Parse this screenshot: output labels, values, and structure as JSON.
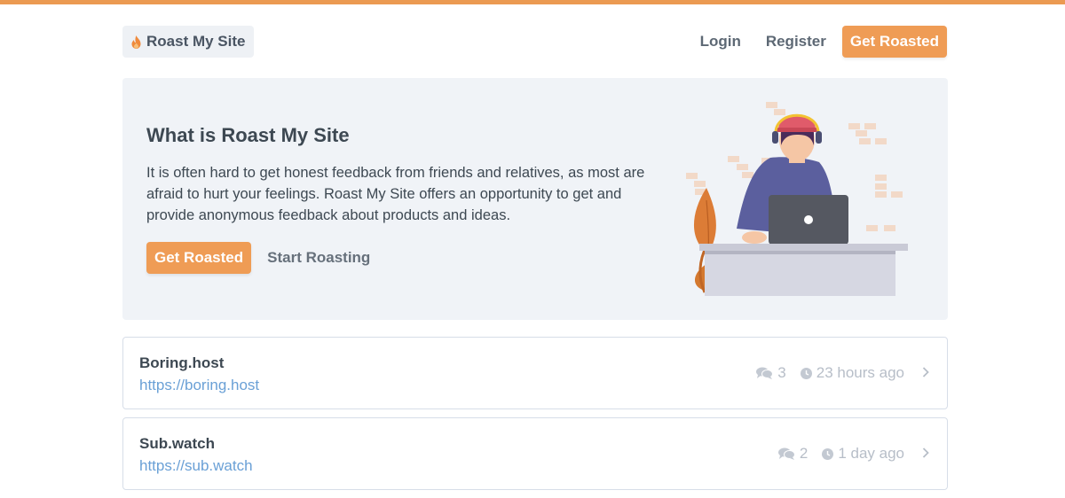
{
  "header": {
    "logo_text": "Roast My Site",
    "nav": {
      "login": "Login",
      "register": "Register",
      "cta": "Get Roasted"
    }
  },
  "hero": {
    "title": "What is Roast My Site",
    "description": "It is often hard to get honest feedback from friends and relatives, as most are afraid to hurt your feelings. Roast My Site offers an opportunity to get and provide anonymous feedback about products and ideas.",
    "primary_button": "Get Roasted",
    "secondary_link": "Start Roasting"
  },
  "sites": [
    {
      "name": "Boring.host",
      "url": "https://boring.host",
      "comments": "3",
      "time": "23 hours ago"
    },
    {
      "name": "Sub.watch",
      "url": "https://sub.watch",
      "comments": "2",
      "time": "1 day ago"
    }
  ],
  "colors": {
    "accent": "#ef9c55",
    "top_bar": "#eb9a52",
    "link": "#6aa0d6",
    "hero_bg": "#f0f3f7",
    "muted": "#b7bec8"
  },
  "icons": {
    "logo": "flame-icon",
    "comments": "comments-icon",
    "time": "clock-icon",
    "open": "chevron-right-icon"
  }
}
